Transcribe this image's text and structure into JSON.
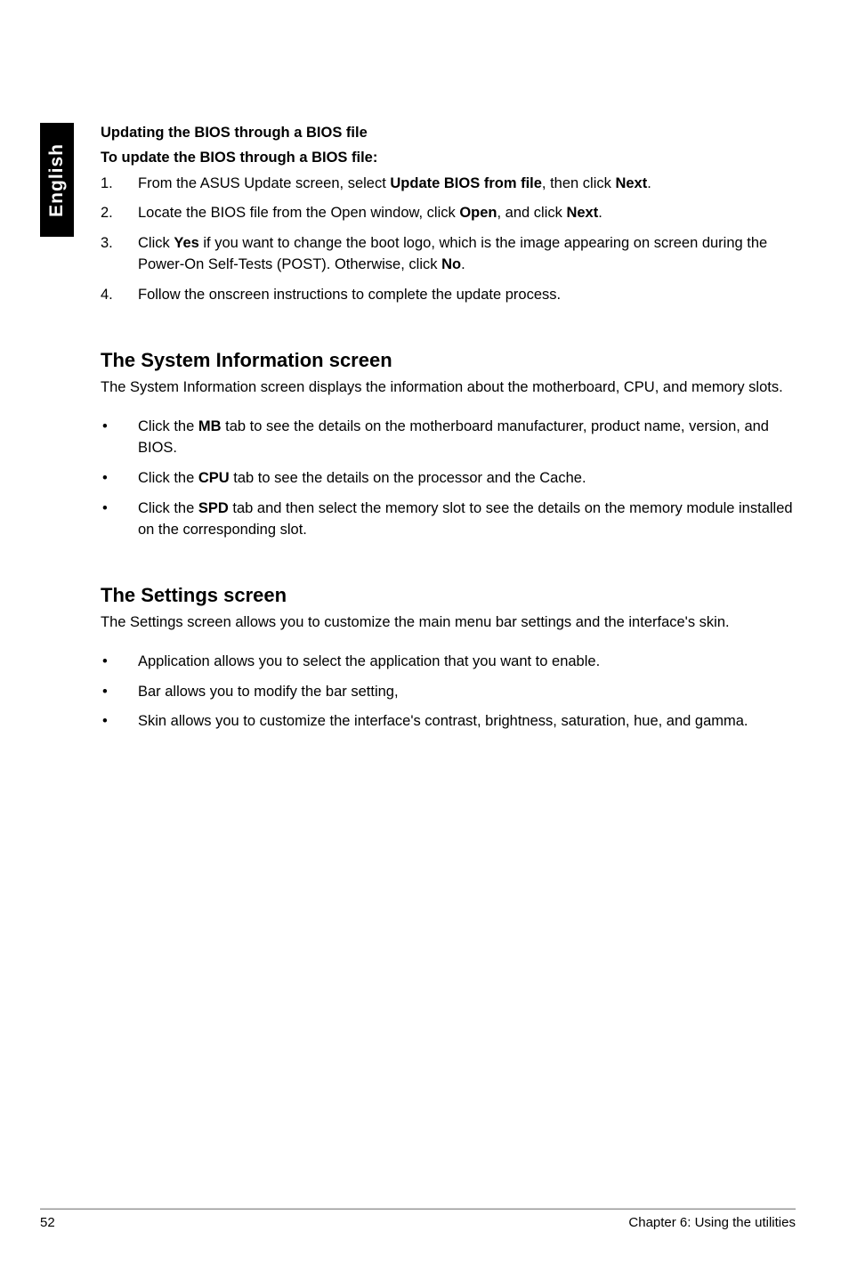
{
  "sidebar": {
    "label": "English"
  },
  "block1": {
    "heading1": "Updating the BIOS through a BIOS file",
    "heading2": "To update the BIOS through a BIOS file:",
    "items": [
      {
        "num": "1.",
        "pre": "From the ASUS Update screen, select ",
        "b1": "Update BIOS from file",
        "mid": ", then click ",
        "b2": "Next",
        "post": "."
      },
      {
        "num": "2.",
        "pre": "Locate the BIOS file from the Open window, click ",
        "b1": "Open",
        "mid": ", and click ",
        "b2": "Next",
        "post": "."
      },
      {
        "num": "3.",
        "pre": "Click ",
        "b1": "Yes",
        "mid": " if you want to change the boot logo, which is the image appearing on screen during the Power-On Self-Tests (POST). Otherwise, click ",
        "b2": "No",
        "post": "."
      },
      {
        "num": "4.",
        "text": "Follow the onscreen instructions to complete the update process."
      }
    ]
  },
  "block2": {
    "title": "The System Information screen",
    "para": "The System Information screen displays the information about the motherboard, CPU, and memory slots.",
    "items": [
      {
        "pre": "Click the ",
        "b": "MB",
        "post": " tab to see the details on the motherboard manufacturer, product name, version, and BIOS."
      },
      {
        "pre": "Click the ",
        "b": "CPU",
        "post": " tab to see the details on the processor and the Cache."
      },
      {
        "pre": "Click the ",
        "b": "SPD",
        "post": " tab and then select the memory slot to see the details on the memory module installed on the corresponding slot."
      }
    ]
  },
  "block3": {
    "title": "The Settings screen",
    "para": "The Settings screen allows you to customize the main menu bar settings and the interface's skin.",
    "items": [
      {
        "text": "Application allows you to select the application that you want to enable."
      },
      {
        "text": "Bar allows you to modify the bar setting,"
      },
      {
        "text": "Skin allows you to customize the interface's contrast, brightness, saturation, hue, and gamma."
      }
    ]
  },
  "footer": {
    "page": "52",
    "chapter": "Chapter 6: Using the utilities"
  }
}
